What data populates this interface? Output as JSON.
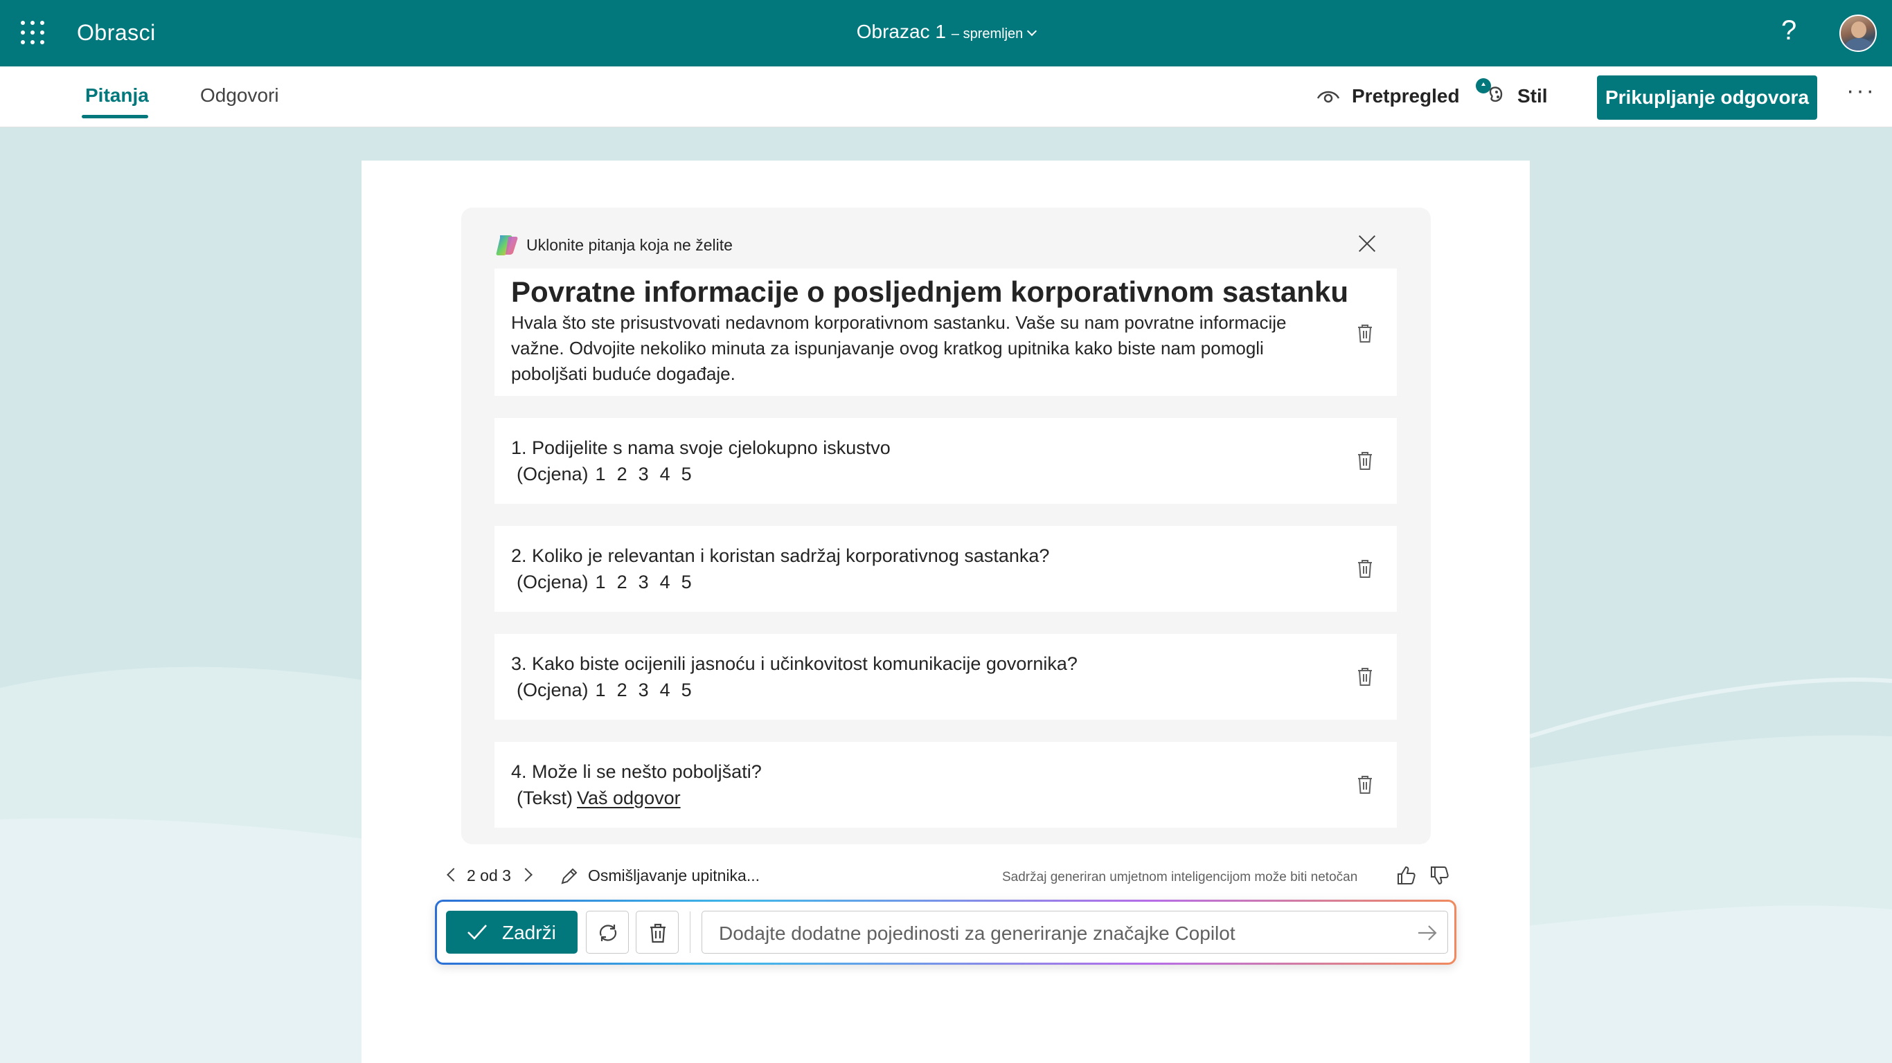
{
  "app": {
    "name": "Obrasci"
  },
  "document": {
    "title": "Obrazac 1",
    "status": "– spremljen"
  },
  "toolbar": {
    "tabs": [
      {
        "label": "Pitanja",
        "active": true
      },
      {
        "label": "Odgovori",
        "active": false
      }
    ],
    "preview_label": "Pretpregled",
    "style_label": "Stil",
    "collect_label": "Prikupljanje odgovora",
    "more_label": "···",
    "help_label": "?"
  },
  "copilot": {
    "header": "Uklonite pitanja koja ne želite",
    "form_title": "Povratne informacije o posljednjem korporativnom sastanku",
    "form_description": "Hvala što ste prisustvovati nedavnom korporativnom sastanku. Vaše su nam povratne informacije važne. Odvojite nekoliko minuta za ispunjavanje ovog kratkog upitnika kako biste nam pomogli poboljšati buduće događaje.",
    "questions": [
      {
        "text": "1. Podijelite s nama svoje cjelokupno iskustvo",
        "type_label": "(Ocjena)",
        "scale": [
          "1",
          "2",
          "3",
          "4",
          "5"
        ]
      },
      {
        "text": "2. Koliko je relevantan i koristan sadržaj korporativnog sastanka?",
        "type_label": "(Ocjena)",
        "scale": [
          "1",
          "2",
          "3",
          "4",
          "5"
        ]
      },
      {
        "text": "3. Kako biste ocijenili jasnoću i učinkovitost komunikacije govornika?",
        "type_label": "(Ocjena)",
        "scale": [
          "1",
          "2",
          "3",
          "4",
          "5"
        ]
      },
      {
        "text": "4. Može li se nešto poboljšati?",
        "type_label": "(Tekst)",
        "answer_placeholder": "Vaš odgovor"
      }
    ],
    "pagination": "2 od 3",
    "status": "Osmišljavanje upitnika...",
    "disclaimer": "Sadržaj generiran umjetnom inteligencijom može biti netočan"
  },
  "compose": {
    "keep_label": "Zadrži",
    "prompt_placeholder": "Dodajte dodatne pojedinosti za generiranje značajke Copilot"
  },
  "colors": {
    "brand": "#03787c",
    "background": "#d3e7e8",
    "card": "#f5f5f5"
  }
}
